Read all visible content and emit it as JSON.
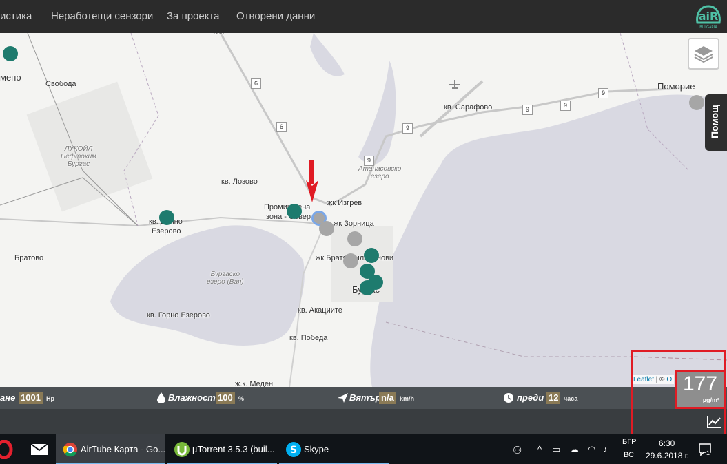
{
  "nav": {
    "items": [
      "истика",
      "Неработещи сензори",
      "За проекта",
      "Отворени данни"
    ],
    "logo_text": "BULGARIA"
  },
  "map": {
    "places": {
      "menо": "мено",
      "svoboda": "Свобода",
      "lukoil": "ЛУКОЙЛ\nНефтохим\nБургас",
      "lozovo": "кв. Лозово",
      "promishlena": "Промишлена",
      "zona_sever": "зона - Север",
      "izgrev": "жк Изгрев",
      "zornitsa": "жк Зорница",
      "bratya": "жк Братя Миладинови",
      "burgas": "Бургас",
      "dolno_ezerovo_1": "кв. Долно",
      "dolno_ezerovo_2": "Езерово",
      "bratovo": "Братово",
      "burgasko_ezero": "Бургаско\nезеро (Вая)",
      "gorno_ezerovo": "кв. Горно Езерово",
      "akatsiite": "кв. Акациите",
      "pobeda": "кв. Победа",
      "meden": "ж.к. Меден",
      "sarafovo": "кв. Сарафово",
      "pomorie": "Поморие",
      "atanasovsko": "Атанасовско\nезеро"
    },
    "road_numbers": [
      "6",
      "6",
      "9",
      "9",
      "9",
      "9",
      "9"
    ],
    "road_top": "360",
    "sensor_colors": {
      "good": "#1e7b6e",
      "no_data": "#a6a6a6"
    }
  },
  "help_label": "Помощ",
  "attribution": {
    "leaflet": "Leaflet",
    "sep": " | © ",
    "o": "O"
  },
  "info": {
    "pressure_label": "ане",
    "pressure_value": "1001",
    "pressure_unit": "Hp",
    "humidity_label": "Влажност",
    "humidity_value": "100",
    "humidity_unit": "%",
    "wind_label": "Вятър",
    "wind_value": "n/a",
    "wind_unit": "km/h",
    "ago_label": "преди",
    "ago_value": "12",
    "ago_unit": "часа"
  },
  "pm": {
    "value": "177",
    "unit": "µg/m³"
  },
  "taskbar": {
    "apps": [
      {
        "label": "AirTube Карта - Go...",
        "active": true
      },
      {
        "label": "µTorrent 3.5.3  (buil...",
        "active": false
      },
      {
        "label": "Skype",
        "active": false
      }
    ],
    "lang_top": "БГР",
    "lang_bottom": "ВС",
    "time": "6:30",
    "date": "29.6.2018 г.",
    "notifications": "1"
  }
}
